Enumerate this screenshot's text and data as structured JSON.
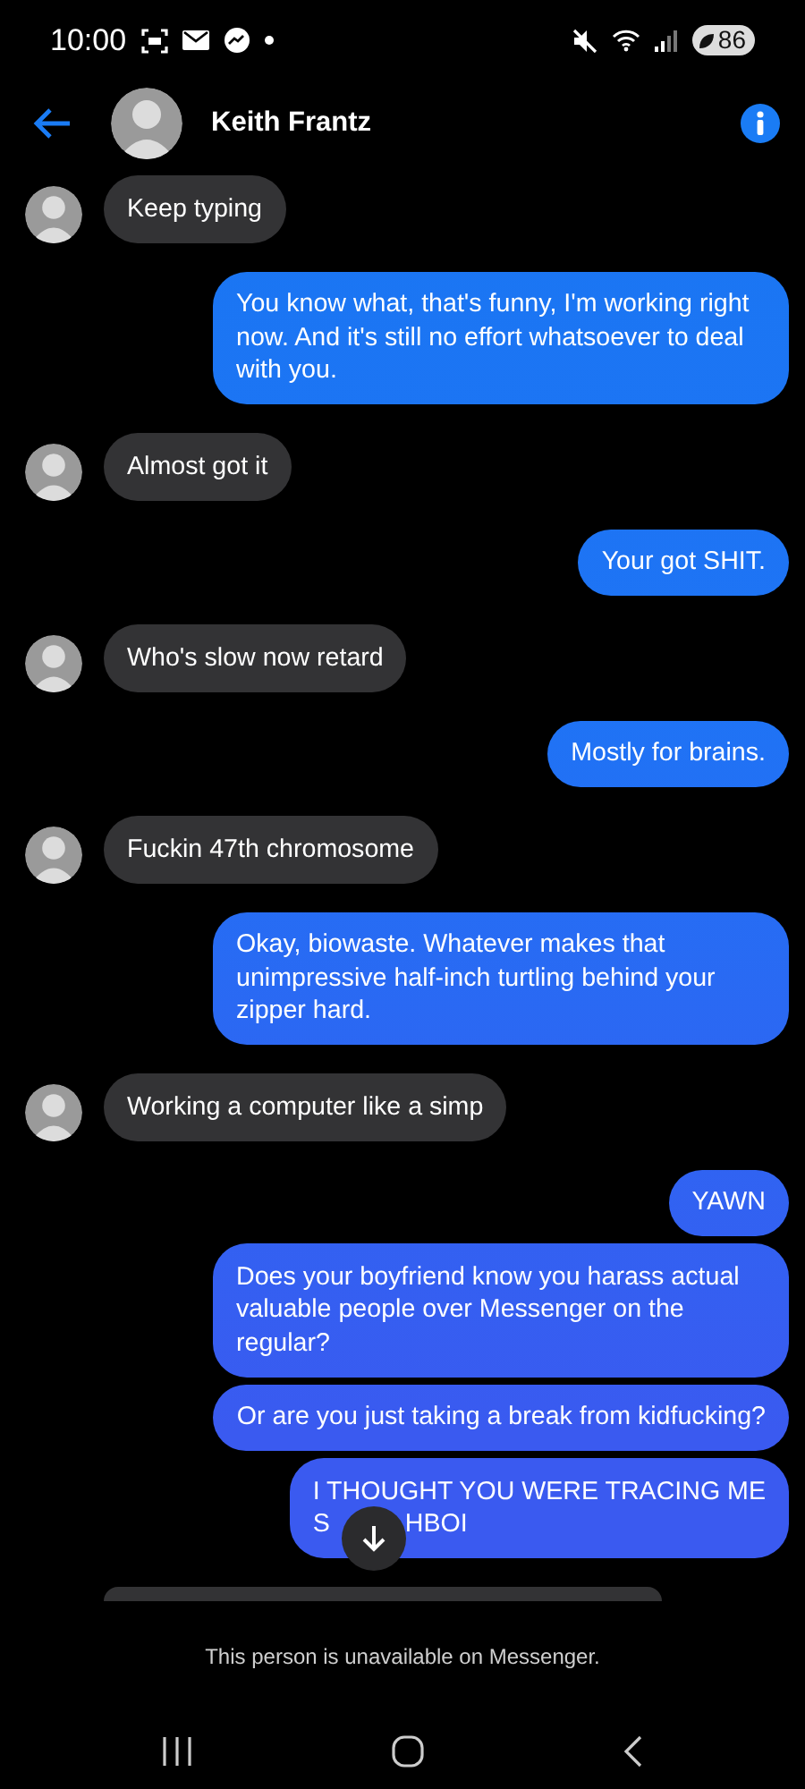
{
  "status_bar": {
    "time": "10:00",
    "battery": "86"
  },
  "header": {
    "contact_name": "Keith Frantz"
  },
  "messages": [
    {
      "outgoing": false,
      "kind": "text",
      "text": "Keep typing"
    },
    {
      "outgoing": true,
      "kind": "text",
      "text": "You know what, that's funny, I'm working right now. And it's still no effort whatsoever to deal with you."
    },
    {
      "outgoing": false,
      "kind": "text",
      "text": "Almost got it"
    },
    {
      "outgoing": true,
      "kind": "text",
      "text": "Your got SHIT."
    },
    {
      "outgoing": false,
      "kind": "text",
      "text": "Who's slow now retard"
    },
    {
      "outgoing": true,
      "kind": "text",
      "text": "Mostly for brains."
    },
    {
      "outgoing": false,
      "kind": "text",
      "text": "Fuckin 47th chromosome"
    },
    {
      "outgoing": true,
      "kind": "text",
      "text": "Okay, biowaste. Whatever makes that unimpressive half-inch turtling behind your zipper hard."
    },
    {
      "outgoing": false,
      "kind": "text",
      "text": "Working a computer like a simp"
    },
    {
      "outgoing": true,
      "kind": "text",
      "text": "YAWN"
    },
    {
      "outgoing": true,
      "kind": "text",
      "text": "Does your boyfriend know you harass actual valuable people over Messenger on the regular?"
    },
    {
      "outgoing": true,
      "kind": "text",
      "text": "Or are you just taking a break from kidfucking?"
    },
    {
      "outgoing": true,
      "kind": "covered",
      "text": "I THOUGHT YOU WERE TRACING ME",
      "covered_line": [
        "S",
        "HBOI"
      ]
    },
    {
      "outgoing": false,
      "kind": "cut"
    }
  ],
  "footer": {
    "notice": "This person is unavailable on Messenger."
  }
}
